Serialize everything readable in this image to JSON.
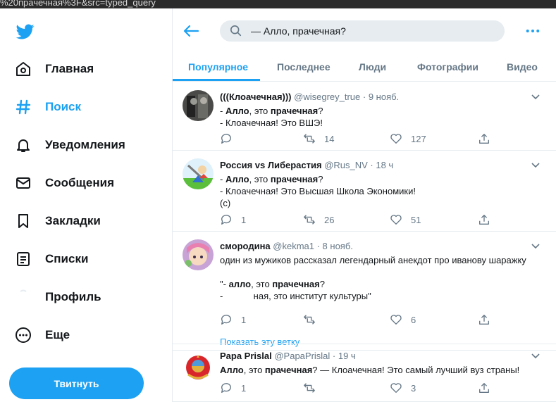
{
  "url_fragment": "%20прачечная%3F&src=typed_query",
  "colors": {
    "accent": "#1da1f2",
    "text": "#14171a",
    "muted": "#657786",
    "border": "#e6ecf0"
  },
  "sidebar": {
    "logo_icon": "twitter-bird-icon",
    "items": [
      {
        "label": "Главная",
        "icon": "home-icon"
      },
      {
        "label": "Поиск",
        "icon": "hashtag-icon"
      },
      {
        "label": "Уведомления",
        "icon": "bell-icon"
      },
      {
        "label": "Сообщения",
        "icon": "envelope-icon"
      },
      {
        "label": "Закладки",
        "icon": "bookmark-icon"
      },
      {
        "label": "Списки",
        "icon": "list-icon"
      },
      {
        "label": "Профиль",
        "icon": "profile-icon"
      },
      {
        "label": "Еще",
        "icon": "more-circle-icon"
      }
    ],
    "tweet_button": "Твитнуть"
  },
  "header": {
    "search_value": "— Алло, прачечная?"
  },
  "tabs": [
    {
      "label": "Популярное",
      "active": true
    },
    {
      "label": "Последнее"
    },
    {
      "label": "Люди"
    },
    {
      "label": "Фотографии"
    },
    {
      "label": "Видео"
    }
  ],
  "tweets": [
    {
      "name": "(((Клоачечная)))",
      "meta": "@wisegrey_true · 9 нояб.",
      "lines": [
        {
          "pre": "- ",
          "b1": "Алло",
          "mid": ", это ",
          "b2": "прачечная",
          "post": "?"
        },
        {
          "text": "- Клоачечная! Это ВШЭ!"
        }
      ],
      "reply": "",
      "retweet": "14",
      "like": "127"
    },
    {
      "name": "Россия vs Либерастия",
      "meta": "@Rus_NV · 18 ч",
      "lines": [
        {
          "pre": "- ",
          "b1": "Алло",
          "mid": ", это ",
          "b2": "прачечная",
          "post": "?"
        },
        {
          "text": "- Клоачечная! Это Высшая Школа Экономики!"
        },
        {
          "text": "(c)"
        }
      ],
      "reply": "1",
      "retweet": "26",
      "like": "51"
    },
    {
      "name": "смородина",
      "meta": "@kekma1 · 8 нояб.",
      "lines": [
        {
          "text": "один из мужиков рассказал легендарный анекдот про иванову шаражку"
        },
        {
          "text": ""
        },
        {
          "pre": "\"- ",
          "b1": "алло",
          "mid": ", это ",
          "b2": "прачечная",
          "post": "?"
        },
        {
          "text": "-            ная, это институт культуры\""
        }
      ],
      "reply": "1",
      "retweet": "",
      "like": "6",
      "show_thread": "Показать эту ветку"
    },
    {
      "name": "Papa Prislal",
      "meta": "@PapaPrislal · 19 ч",
      "lines": [
        {
          "pre": "",
          "b1": "Алло",
          "mid": ", это ",
          "b2": "прачечная",
          "post": "? — Клоачечная! Это самый лучший вуз страны!"
        }
      ],
      "reply": "1",
      "retweet": "",
      "like": "3"
    }
  ]
}
